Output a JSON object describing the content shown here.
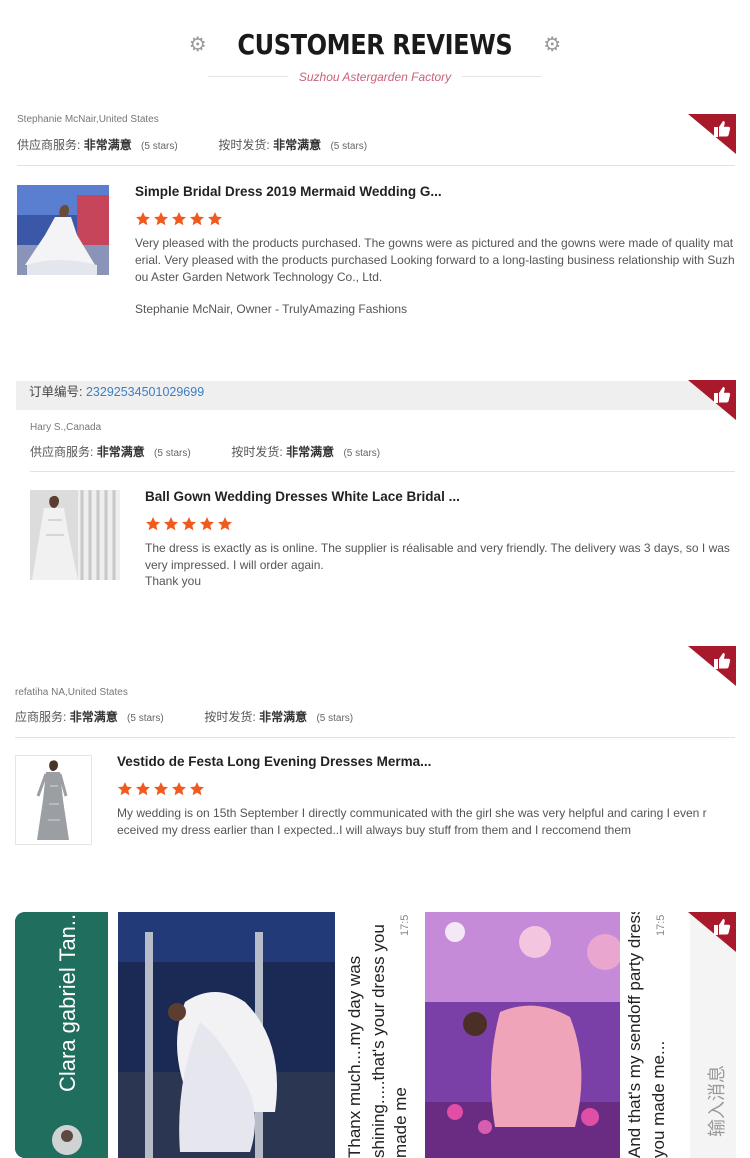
{
  "header": {
    "title": "CUSTOMER REVIEWS",
    "subtitle": "Suzhou Astergarden Factory"
  },
  "reviews": [
    {
      "reviewer": "Stephanie McNair,United States",
      "service_label": "供应商服务:",
      "service_value": "非常满意",
      "service_stars": "(5 stars)",
      "shipping_label": "按时发货:",
      "shipping_value": "非常满意",
      "shipping_stars": "(5 stars)",
      "product_title": "Simple Bridal Dress 2019 Mermaid Wedding G...",
      "rating": 5,
      "text": "Very pleased with the products purchased. The gowns were as pictured and the gowns were made of quality material.  Very pleased with the products purchased Looking forward to a long-lasting business relationship with Suzhou Aster Garden Network Technology Co., Ltd.",
      "signature": "Stephanie McNair, Owner - TrulyAmazing Fashions"
    },
    {
      "order_label": "订单编号:",
      "order_number": "23292534501029699",
      "reviewer": "Hary S.,Canada",
      "service_label": "供应商服务:",
      "service_value": "非常满意",
      "service_stars": "(5 stars)",
      "shipping_label": "按时发货:",
      "shipping_value": "非常满意",
      "shipping_stars": "(5 stars)",
      "product_title": "Ball Gown Wedding Dresses White Lace Bridal ...",
      "rating": 5,
      "text": "The dress is exactly as is online. The supplier is réalisable and very friendly. The delivery was 3 days, so I was very impressed. I will order again.",
      "text2": "Thank you"
    },
    {
      "reviewer": "refatiha NA,United States",
      "service_label": "应商服务:",
      "service_value": "非常满意",
      "service_stars": "(5 stars)",
      "shipping_label": "按时发货:",
      "shipping_value": "非常满意",
      "shipping_stars": "(5 stars)",
      "product_title": "Vestido de Festa Long Evening Dresses Merma...",
      "rating": 5,
      "text": "My wedding is on 15th September I directly communicated with the girl she was very helpful and caring I even received my dress earlier than I expected..I will always buy stuff from them and I reccomend them"
    }
  ],
  "chat_collage": {
    "contact_name": "Clara gabriel Tan...",
    "message1_line1": "Thanx much....my day was",
    "message1_line2": "shining.....that's your dress you",
    "message1_line3": "made me",
    "message2_line1": "And that's my sendoff party dress",
    "message2_line2": "you  made me...",
    "time": "17:5",
    "input_placeholder": "输入消息"
  },
  "colors": {
    "badge": "#a8192b",
    "star": "#f15a1e",
    "order_number": "#3d7ec5",
    "subtitle": "#c7627a"
  }
}
